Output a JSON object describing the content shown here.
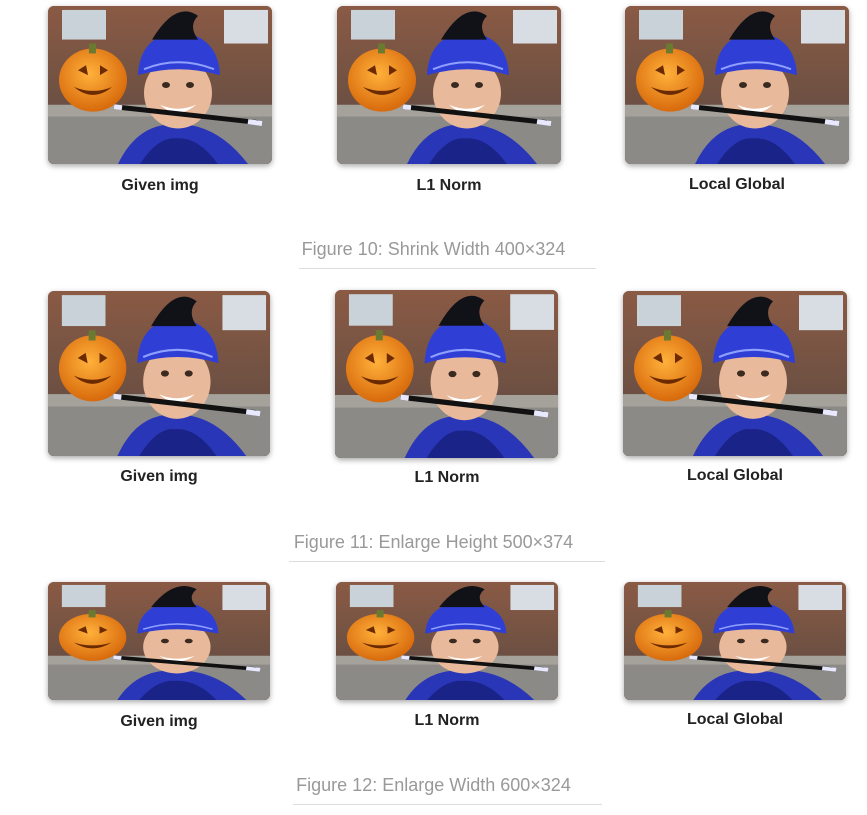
{
  "figures": [
    {
      "labels": [
        "Given img",
        "L1 Norm",
        "Local Global"
      ],
      "caption": "Figure 10: Shrink Width 400×324"
    },
    {
      "labels": [
        "Given img",
        "L1 Norm",
        "Local Global"
      ],
      "caption": "Figure 11: Enlarge Height 500×374"
    },
    {
      "labels": [
        "Given img",
        "L1 Norm",
        "Local Global"
      ],
      "caption": "Figure 12: Enlarge Width 600×324"
    }
  ],
  "colors": {
    "caption_text": "#999999",
    "label_text": "#222222",
    "hat_blue": "#2f3fd6",
    "pumpkin_orange": "#f0861a",
    "brick": "#7a4a38"
  }
}
